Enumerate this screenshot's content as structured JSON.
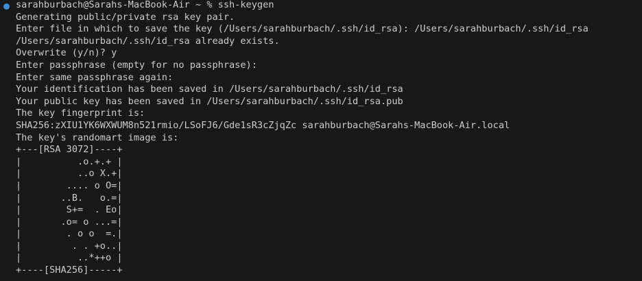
{
  "terminal": {
    "prompt_indicator_color": "#3a8fd6",
    "lines": [
      "sarahburbach@Sarahs-MacBook-Air ~ % ssh-keygen",
      "Generating public/private rsa key pair.",
      "Enter file in which to save the key (/Users/sarahburbach/.ssh/id_rsa): /Users/sarahburbach/.ssh/id_rsa",
      "/Users/sarahburbach/.ssh/id_rsa already exists.",
      "Overwrite (y/n)? y",
      "Enter passphrase (empty for no passphrase):",
      "Enter same passphrase again:",
      "Your identification has been saved in /Users/sarahburbach/.ssh/id_rsa",
      "Your public key has been saved in /Users/sarahburbach/.ssh/id_rsa.pub",
      "The key fingerprint is:",
      "SHA256:zXIU1YK6WXWUM8n521rmio/LSoFJ6/Gde1sR3cZjqZc sarahburbach@Sarahs-MacBook-Air.local",
      "The key's randomart image is:",
      "+---[RSA 3072]----+",
      "|          .o.+.+ |",
      "|          ..o X.+|",
      "|        .... o O=|",
      "|       ..B.   o.=|",
      "|        S+=  . Eo|",
      "|       .o= o ...=|",
      "|        . o o  =.|",
      "|         . . +o..|",
      "|          ..*++o |",
      "+----[SHA256]-----+"
    ]
  }
}
